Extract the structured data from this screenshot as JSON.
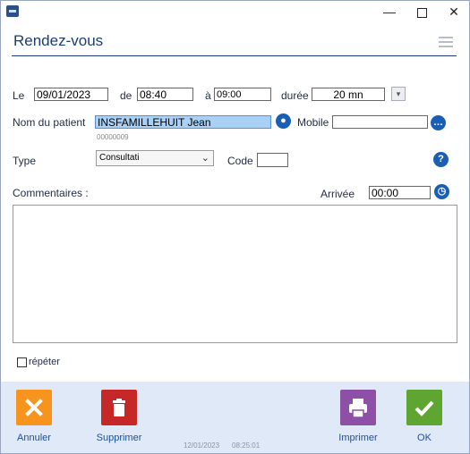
{
  "window": {
    "icon": "app-icon"
  },
  "header": {
    "title": "Rendez-vous"
  },
  "form": {
    "date_label": "Le",
    "date_value": "09/01/2023",
    "from_label": "de",
    "from_value": "08:40",
    "to_label": "à",
    "to_value": "09:00",
    "duration_label": "durée",
    "duration_value": "20 mn",
    "patient_label": "Nom du patient",
    "patient_value": "INSFAMILLEHUIT Jean",
    "patient_id": "00000009",
    "mobile_label": "Mobile",
    "mobile_value": "",
    "type_label": "Type",
    "type_value": "Consultati",
    "code_label": "Code",
    "code_value": "",
    "comments_label": "Commentaires :",
    "arrival_label": "Arrivée",
    "arrival_value": "00:00",
    "repeat_label": "répéter"
  },
  "footer": {
    "cancel_label": "Annuler",
    "delete_label": "Supprimer",
    "print_label": "Imprimer",
    "ok_label": "OK",
    "meta_date": "12/01/2023",
    "meta_time": "08:25:01"
  },
  "colors": {
    "cancel": "#f7941d",
    "delete": "#c62828",
    "print": "#8e4fa6",
    "ok": "#5fa532",
    "accent": "#1a5fb4"
  }
}
